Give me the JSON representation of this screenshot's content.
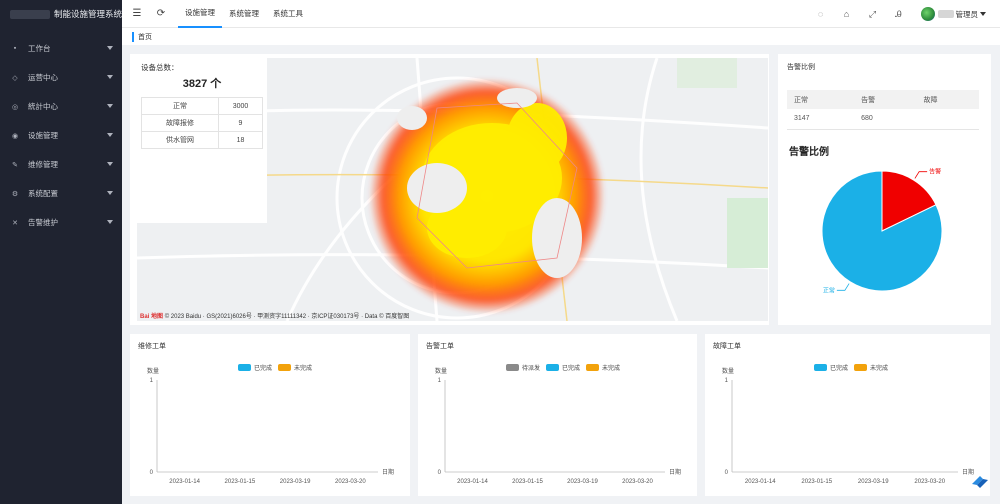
{
  "app": {
    "title_suffix": "制能设施管理系统"
  },
  "sidebar": {
    "items": [
      {
        "label": "工作台",
        "icon": "dashboard-icon"
      },
      {
        "label": "运营中心",
        "icon": "operation-icon"
      },
      {
        "label": "統計中心",
        "icon": "statistics-icon"
      },
      {
        "label": "设施管理",
        "icon": "facility-icon"
      },
      {
        "label": "维修管理",
        "icon": "repair-icon"
      },
      {
        "label": "系统配置",
        "icon": "config-icon"
      },
      {
        "label": "告警维护",
        "icon": "alarm-icon"
      }
    ]
  },
  "header": {
    "nav": [
      "设施管理",
      "系统管理",
      "系统工具"
    ],
    "user_name": "管理员"
  },
  "tags": {
    "current": "首页"
  },
  "map_stats": {
    "title": "设备总数：",
    "total": "3827 个",
    "rows": [
      {
        "label": "正常",
        "value": "3000"
      },
      {
        "label": "故障报修",
        "value": "9"
      },
      {
        "label": "供水管网",
        "value": "18"
      }
    ]
  },
  "map_footer": {
    "logo": "Bai 地图",
    "text": "© 2023 Baidu · GS(2021)6026号 · 甲测资字11111342 · 京ICP证030173号 · Data © 百度智图"
  },
  "ratio": {
    "title": "告警比例",
    "table_headers": [
      "正常",
      "告警",
      "故障"
    ],
    "table_rows": [
      [
        "3147",
        "680",
        ""
      ]
    ],
    "chart_title": "告警比例",
    "pie_labels": {
      "alarm": "告警",
      "normal": "正常"
    }
  },
  "chart_data": [
    {
      "type": "pie",
      "title": "告警比例",
      "labels": [
        "告警",
        "正常"
      ],
      "values": [
        17.8,
        82.2
      ],
      "colors": [
        "#f00000",
        "#1bb0e7"
      ]
    },
    {
      "type": "bar",
      "title": "维修工单",
      "series": [
        {
          "name": "已完成",
          "values": [
            0,
            0,
            0,
            0
          ],
          "color": "#1bb0e7"
        },
        {
          "name": "未完成",
          "values": [
            0,
            0,
            0,
            0
          ],
          "color": "#f2a20c"
        }
      ],
      "categories": [
        "2023-01-14",
        "2023-01-15",
        "2023-03-19",
        "2023-03-20"
      ],
      "ylabel": "数量",
      "xlabel": "日期",
      "ylim": [
        0,
        1
      ]
    },
    {
      "type": "bar",
      "title": "告警工单",
      "series": [
        {
          "name": "待派发",
          "values": [
            0,
            0,
            0,
            0
          ],
          "color": "#8a8a8a"
        },
        {
          "name": "已完成",
          "values": [
            0,
            0,
            0,
            0
          ],
          "color": "#1bb0e7"
        },
        {
          "name": "未完成",
          "values": [
            0,
            0,
            0,
            0
          ],
          "color": "#f2a20c"
        }
      ],
      "categories": [
        "2023-01-14",
        "2023-01-15",
        "2023-03-19",
        "2023-03-20"
      ],
      "ylabel": "数量",
      "xlabel": "日期",
      "ylim": [
        0,
        1
      ]
    },
    {
      "type": "bar",
      "title": "故障工单",
      "series": [
        {
          "name": "已完成",
          "values": [
            0,
            0,
            0,
            0
          ],
          "color": "#1bb0e7"
        },
        {
          "name": "未完成",
          "values": [
            0,
            0,
            0,
            0
          ],
          "color": "#f2a20c"
        }
      ],
      "categories": [
        "2023-01-14",
        "2023-01-15",
        "2023-03-19",
        "2023-03-20"
      ],
      "ylabel": "数量",
      "xlabel": "日期",
      "ylim": [
        0,
        1
      ]
    }
  ]
}
